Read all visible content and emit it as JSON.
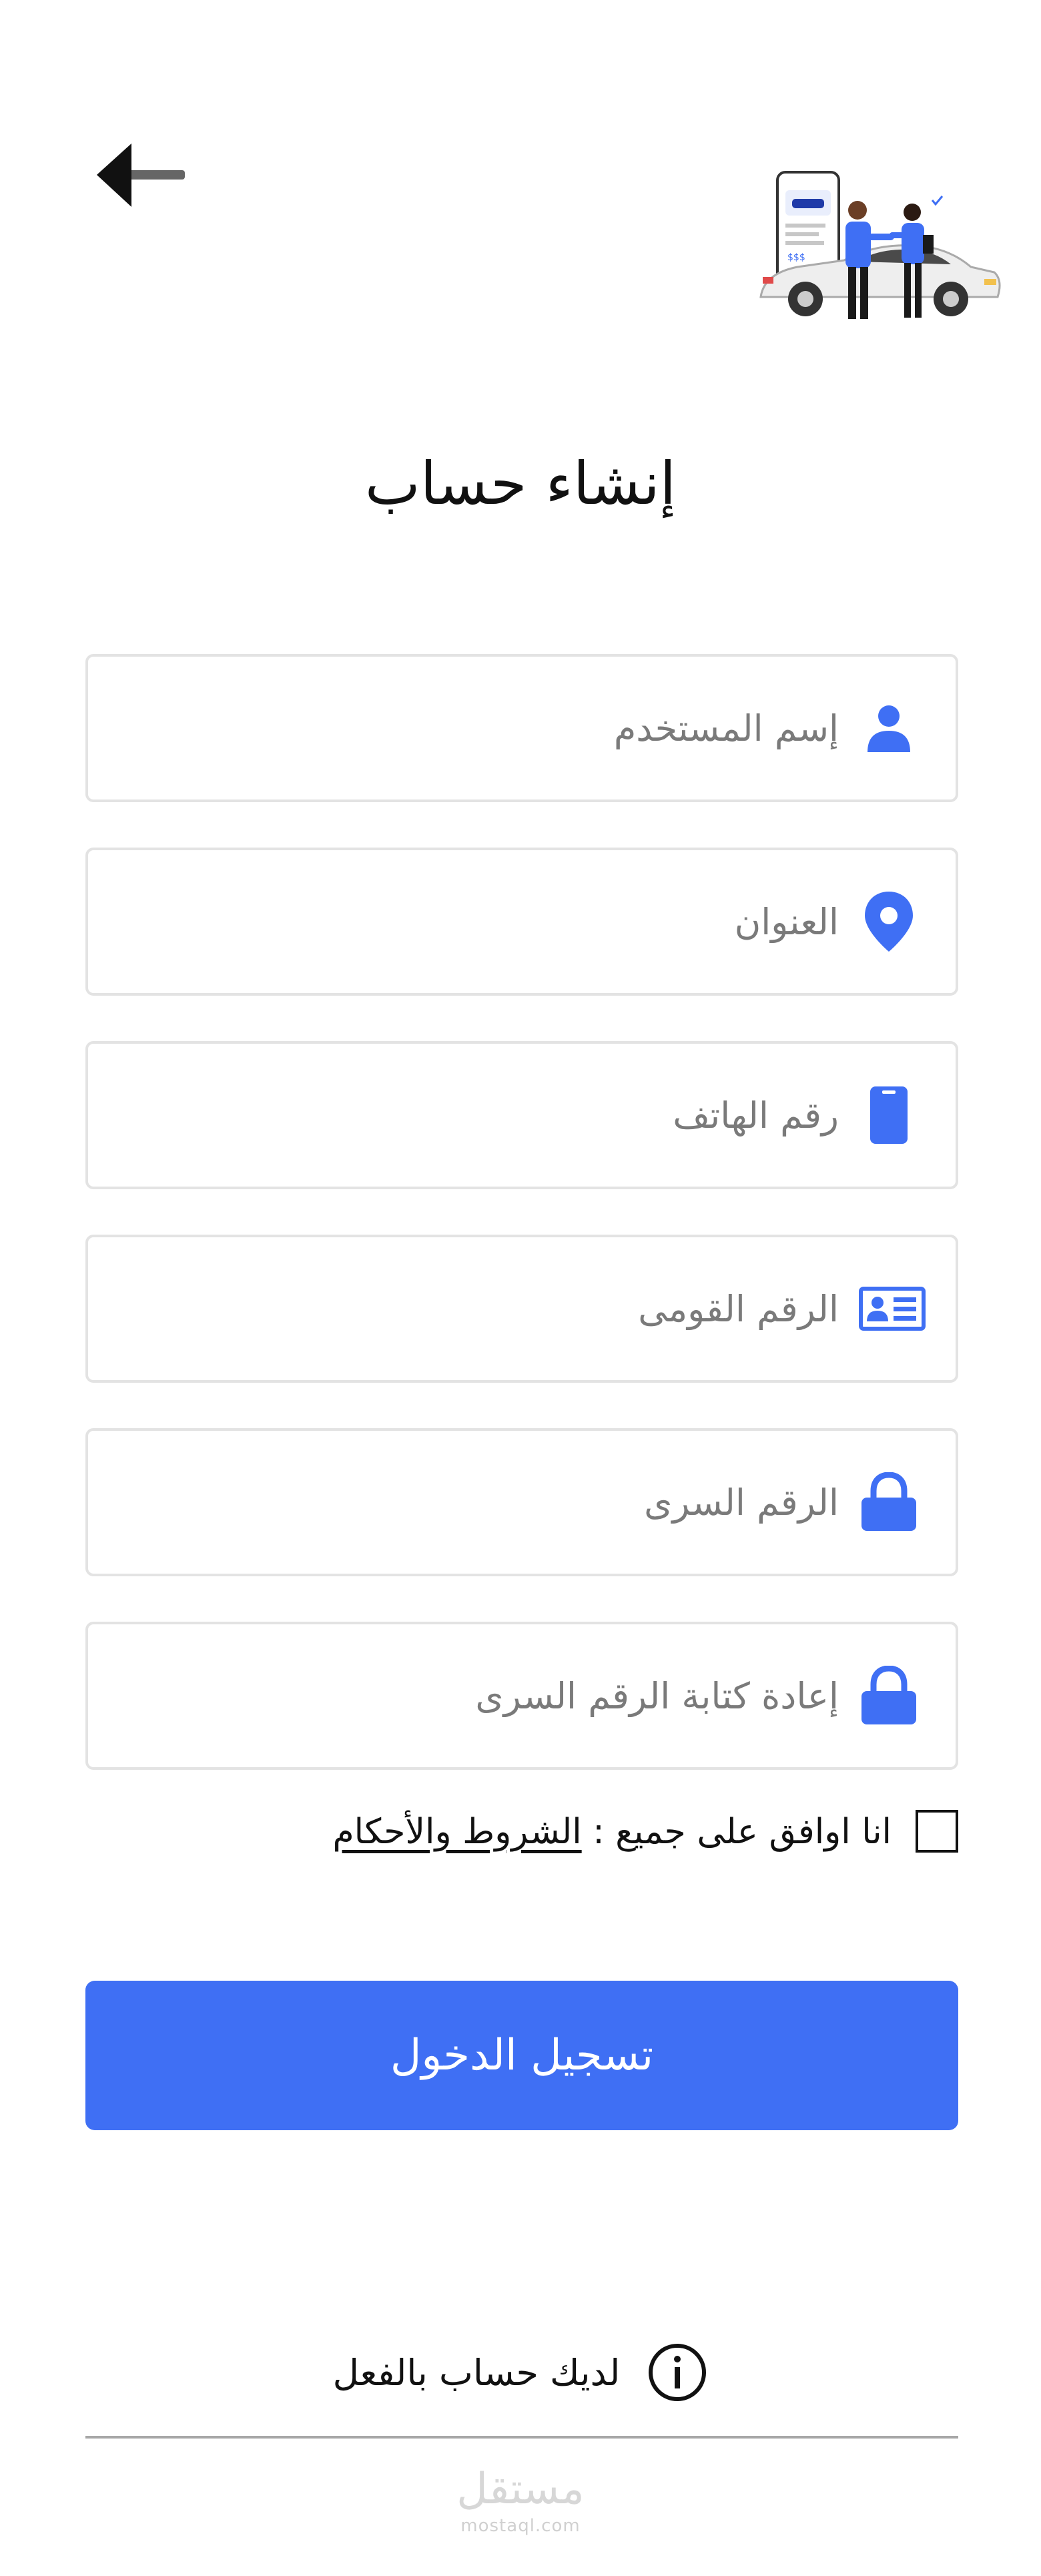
{
  "header": {
    "back_icon": "arrow-left-icon",
    "illustration": "car-rental-handshake-illustration"
  },
  "title": "إنشاء حساب",
  "form": {
    "fields": [
      {
        "placeholder": "إسم المستخدم",
        "icon": "user-icon"
      },
      {
        "placeholder": "العنوان",
        "icon": "location-pin-icon"
      },
      {
        "placeholder": "رقم الهاتف",
        "icon": "phone-icon"
      },
      {
        "placeholder": "الرقم القومى",
        "icon": "id-card-icon"
      },
      {
        "placeholder": "الرقم السرى",
        "icon": "lock-icon"
      },
      {
        "placeholder": "إعادة كتابة الرقم السرى",
        "icon": "lock-icon"
      }
    ],
    "terms_prefix": "انا اوافق على جميع :",
    "terms_link": "الشروط والأحكام",
    "submit_label": "تسجيل الدخول"
  },
  "footer": {
    "have_account": "لديك حساب بالفعل",
    "info_icon": "info-icon",
    "watermark_ar": "مستقل",
    "watermark_en": "mostaql.com"
  },
  "colors": {
    "accent": "#3f6ff4",
    "border": "#e3e3e3",
    "placeholder": "#7a7a7a"
  }
}
